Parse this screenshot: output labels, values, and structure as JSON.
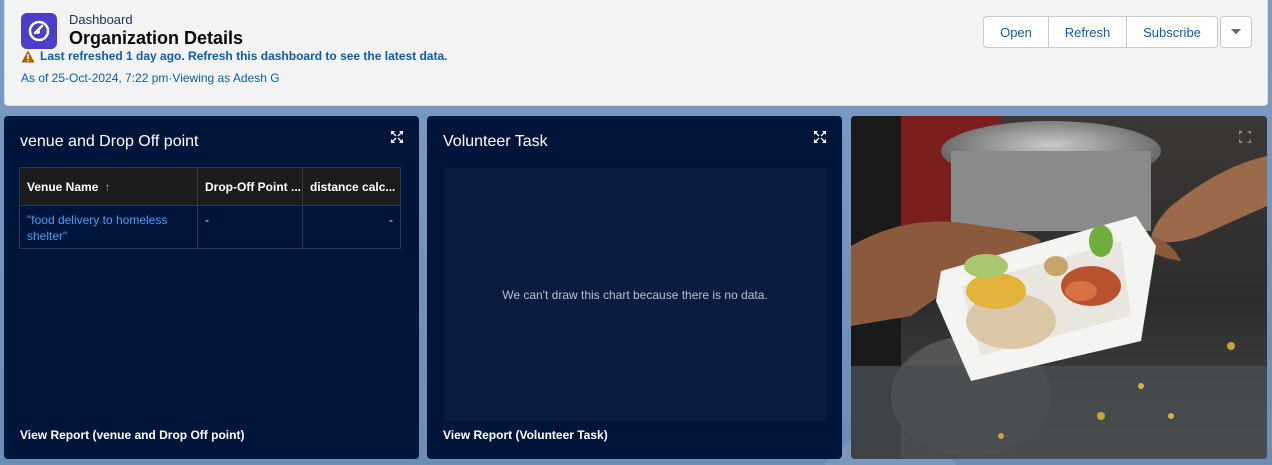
{
  "header": {
    "eyebrow": "Dashboard",
    "title": "Organization Details",
    "warning": "Last refreshed 1 day ago. Refresh this dashboard to see the latest data.",
    "as_of": "As of 25-Oct-2024, 7:22 pm·Viewing as Adesh G",
    "buttons": {
      "open": "Open",
      "refresh": "Refresh",
      "subscribe": "Subscribe"
    }
  },
  "panels": {
    "venue": {
      "title": "venue and Drop Off point",
      "columns": [
        "Venue Name",
        "Drop-Off Point ...",
        "distance calc..."
      ],
      "rows": [
        [
          "\"food delivery to homeless shelter\"",
          "-",
          "-"
        ]
      ],
      "footer": "View Report (venue and Drop Off point)"
    },
    "volunteer": {
      "title": "Volunteer Task",
      "empty_message": "We can't draw this chart because there is no data.",
      "footer": "View Report (Volunteer Task)"
    }
  },
  "colors": {
    "accent": "#0b5cab",
    "panel_bg": "#00153a",
    "brand_icon": "#4b3ec9",
    "warning": "#a86403"
  },
  "icons": [
    "dashboard-icon",
    "warning-icon",
    "chevron-down-icon",
    "expand-icon",
    "sort-up-icon"
  ]
}
